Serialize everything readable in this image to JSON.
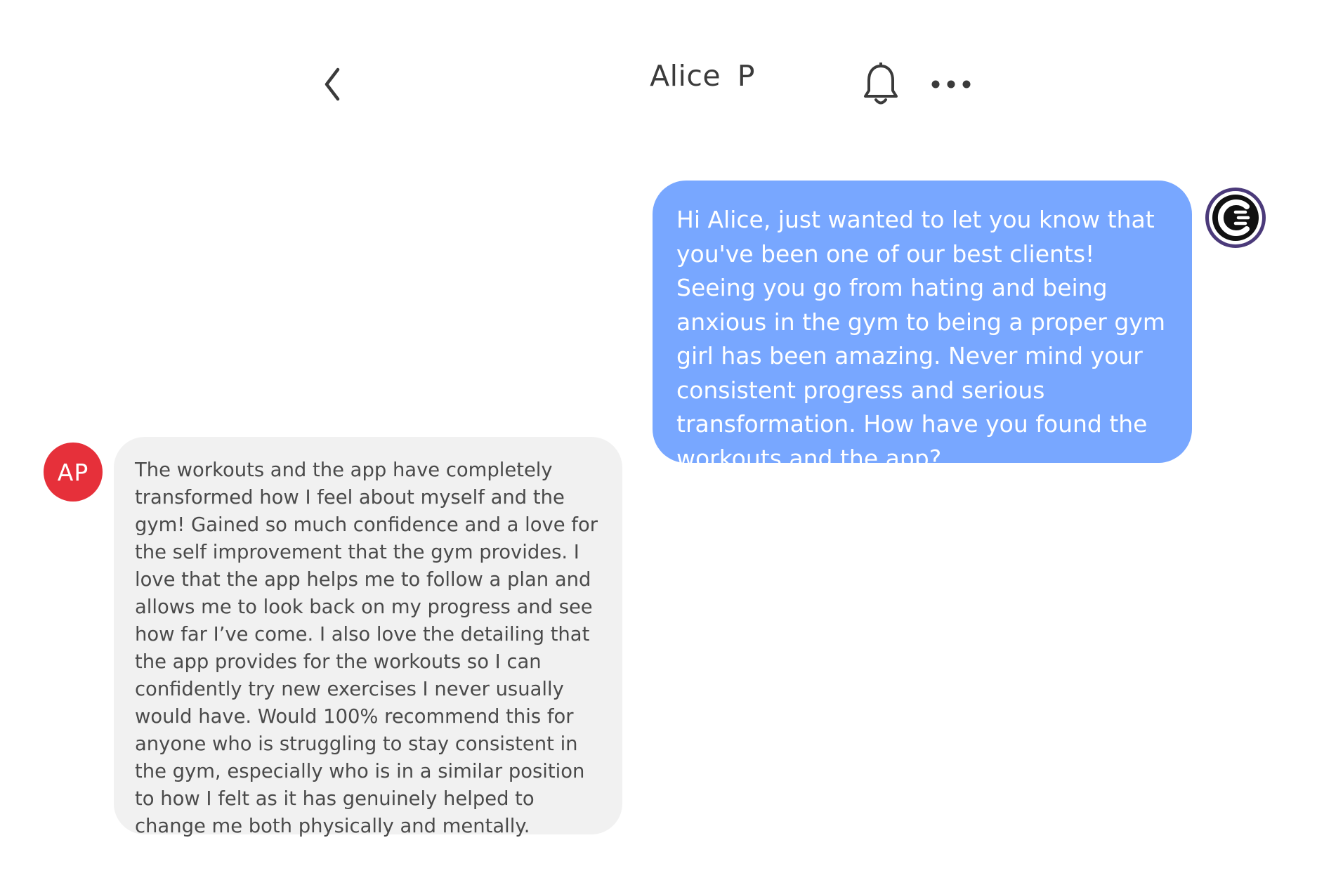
{
  "header": {
    "back_icon": "chevron-left-icon",
    "title": "Alice  P",
    "bell_icon": "bell-icon",
    "more_icon": "more-horizontal-icon"
  },
  "messages": [
    {
      "direction": "outgoing",
      "text": "Hi Alice, just wanted to let you know that you've been one of our best clients! Seeing you go from hating and being anxious in the gym to being a proper gym girl has been amazing. Never mind your consistent progress and serious transformation. How have you found the workouts and the app?",
      "avatar_icon": "brand-logo-icon"
    },
    {
      "direction": "incoming",
      "avatar_initials": "AP",
      "text": "The workouts and the app have completely transformed how I feel about myself and the gym! Gained so much confidence and a love for the self improvement that the gym provides. I love that the app helps me to follow a plan and allows me to look back on my progress and see how far I’ve come. I also love the detailing that the app provides for the workouts so I can confidently try new exercises I never usually would have. Would 100% recommend this for anyone who is struggling to stay consistent in the gym, especially who is in a similar position to how I felt as it has genuinely helped to change me both physically and mentally."
    }
  ],
  "colors": {
    "outgoing_bubble": "#78a7ff",
    "incoming_bubble": "#f1f1f1",
    "avatar_initials_bg": "#e6303a",
    "brand_ring": "#4b3a7a"
  }
}
